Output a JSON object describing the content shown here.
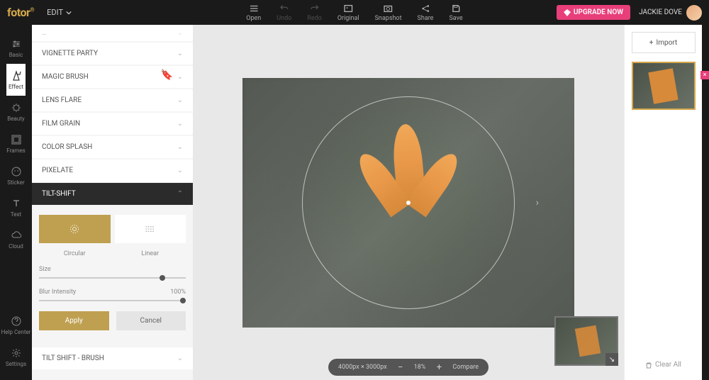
{
  "header": {
    "logo": "fotor",
    "edit_label": "EDIT",
    "tools": [
      {
        "label": "Open",
        "icon": "menu-icon",
        "dim": false
      },
      {
        "label": "Undo",
        "icon": "undo-icon",
        "dim": true
      },
      {
        "label": "Redo",
        "icon": "redo-icon",
        "dim": true
      },
      {
        "label": "Original",
        "icon": "original-icon",
        "dim": false
      },
      {
        "label": "Snapshot",
        "icon": "snapshot-icon",
        "dim": false
      },
      {
        "label": "Share",
        "icon": "share-icon",
        "dim": false
      },
      {
        "label": "Save",
        "icon": "save-icon",
        "dim": false
      }
    ],
    "upgrade_label": "UPGRADE NOW",
    "user_name": "JACKIE DOVE"
  },
  "leftnav": {
    "items": [
      {
        "label": "Basic",
        "icon": "sliders-icon"
      },
      {
        "label": "Effect",
        "icon": "effect-icon"
      },
      {
        "label": "Beauty",
        "icon": "beauty-icon"
      },
      {
        "label": "Frames",
        "icon": "frames-icon"
      },
      {
        "label": "Sticker",
        "icon": "sticker-icon"
      },
      {
        "label": "Text",
        "icon": "text-icon"
      },
      {
        "label": "Cloud",
        "icon": "cloud-icon"
      }
    ],
    "bottom": [
      {
        "label": "Help Center",
        "icon": "help-icon"
      },
      {
        "label": "Settings",
        "icon": "settings-icon"
      }
    ],
    "active_index": 1
  },
  "effects": {
    "items": [
      {
        "label": "VIGNETTE PARTY",
        "bookmark": false
      },
      {
        "label": "MAGIC BRUSH",
        "bookmark": true
      },
      {
        "label": "LENS FLARE",
        "bookmark": false
      },
      {
        "label": "FILM GRAIN",
        "bookmark": false
      },
      {
        "label": "COLOR SPLASH",
        "bookmark": false
      },
      {
        "label": "PIXELATE",
        "bookmark": false
      },
      {
        "label": "TILT-SHIFT",
        "bookmark": false
      }
    ],
    "active_index": 6,
    "after": [
      {
        "label": "TILT SHIFT - BRUSH"
      }
    ]
  },
  "tiltshift": {
    "shapes": {
      "circular": "Circular",
      "linear": "Linear",
      "active": "circular"
    },
    "sliders": {
      "size": {
        "label": "Size",
        "value_pct": 82
      },
      "blur": {
        "label": "Blur Intensity",
        "value_label": "100%",
        "value_pct": 100
      }
    },
    "apply": "Apply",
    "cancel": "Cancel"
  },
  "canvas": {
    "dimensions_label": "4000px × 3000px",
    "zoom_label": "18%",
    "compare_label": "Compare"
  },
  "right": {
    "import_label": "Import",
    "clear_label": "Clear All"
  }
}
